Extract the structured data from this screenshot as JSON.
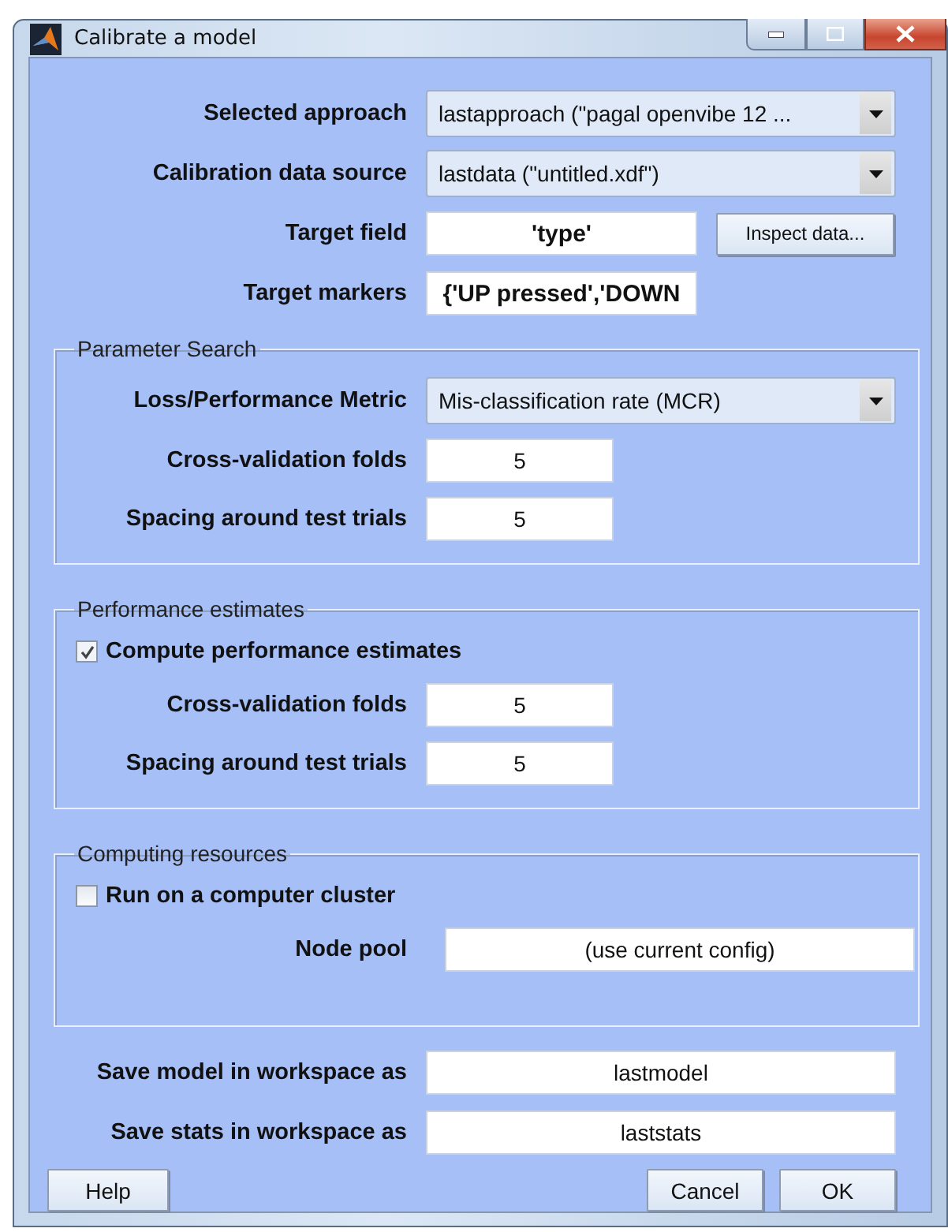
{
  "window": {
    "title": "Calibrate a model"
  },
  "top_rows": [
    {
      "kind": "dropdown",
      "label": "Selected approach",
      "value": "lastapproach (\"pagal openvibe 12 ..."
    },
    {
      "kind": "dropdown",
      "label": "Calibration data source",
      "value": "lastdata (\"untitled.xdf\")"
    },
    {
      "kind": "field_button",
      "label": "Target field",
      "value": "'type'",
      "bold": true,
      "button": "Inspect data..."
    },
    {
      "kind": "field",
      "label": "Target markers",
      "value": "{'UP pressed','DOWN",
      "bold": true
    }
  ],
  "groups": [
    {
      "title": "Parameter Search",
      "rows": [
        {
          "kind": "dropdown",
          "label": "Loss/Performance Metric",
          "value": "Mis-classification rate (MCR)"
        },
        {
          "kind": "short_field",
          "label": "Cross-validation folds",
          "value": "5",
          "bold": false
        },
        {
          "kind": "short_field",
          "label": "Spacing around test trials",
          "value": "5",
          "bold": false
        }
      ]
    },
    {
      "title": "Performance estimates",
      "checkbox": {
        "label": "Compute performance estimates",
        "checked": true
      },
      "rows": [
        {
          "kind": "short_field",
          "label": "Cross-validation folds",
          "value": "5",
          "bold": false
        },
        {
          "kind": "short_field",
          "label": "Spacing around test trials",
          "value": "5",
          "bold": false
        }
      ]
    },
    {
      "title": "Computing resources",
      "checkbox": {
        "label": "Run on a computer cluster",
        "checked": false
      },
      "rows": [
        {
          "kind": "wide_field",
          "label": "Node pool",
          "value": "(use current config)",
          "bold": false
        }
      ]
    }
  ],
  "bottom_rows": [
    {
      "kind": "field",
      "label": "Save model in workspace as",
      "value": "lastmodel",
      "bold": false
    },
    {
      "kind": "field",
      "label": "Save stats in workspace as",
      "value": "laststats",
      "bold": false
    }
  ],
  "buttons": {
    "help": "Help",
    "cancel": "Cancel",
    "ok": "OK"
  }
}
